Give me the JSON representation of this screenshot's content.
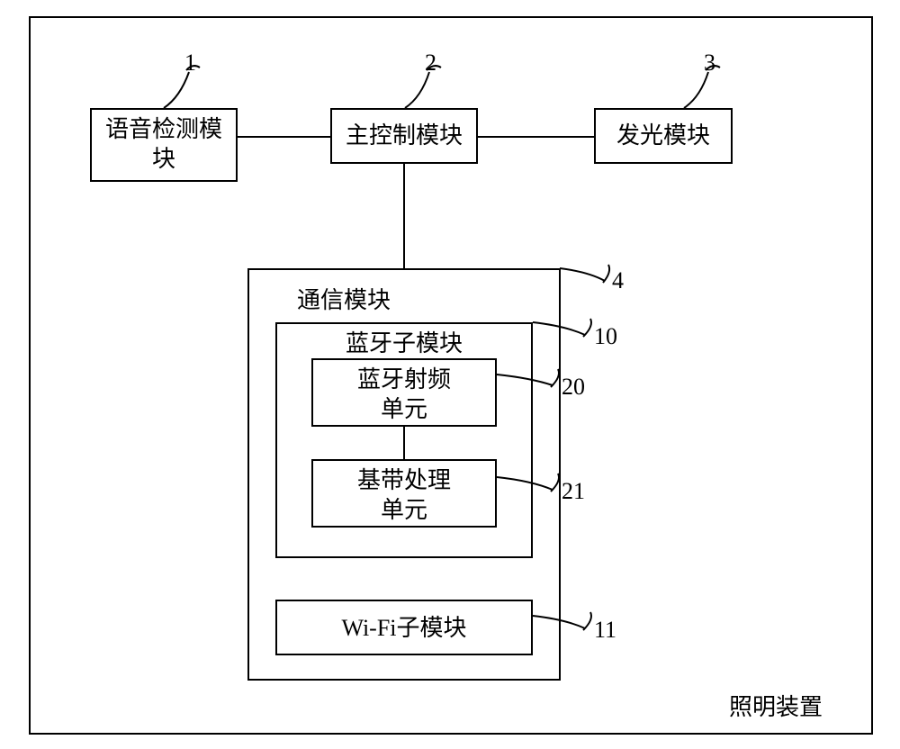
{
  "device_label": "照明装置",
  "blocks": {
    "voice": {
      "label": "语音检测模\n块",
      "ref": "1"
    },
    "main_ctrl": {
      "label": "主控制模块",
      "ref": "2"
    },
    "light": {
      "label": "发光模块",
      "ref": "3"
    },
    "comm": {
      "label": "通信模块",
      "ref": "4"
    },
    "bt_sub": {
      "label": "蓝牙子模块",
      "ref": "10"
    },
    "bt_rf": {
      "label": "蓝牙射频\n单元",
      "ref": "20"
    },
    "baseband": {
      "label": "基带处理\n单元",
      "ref": "21"
    },
    "wifi": {
      "label": "Wi-Fi子模块",
      "ref": "11"
    }
  }
}
